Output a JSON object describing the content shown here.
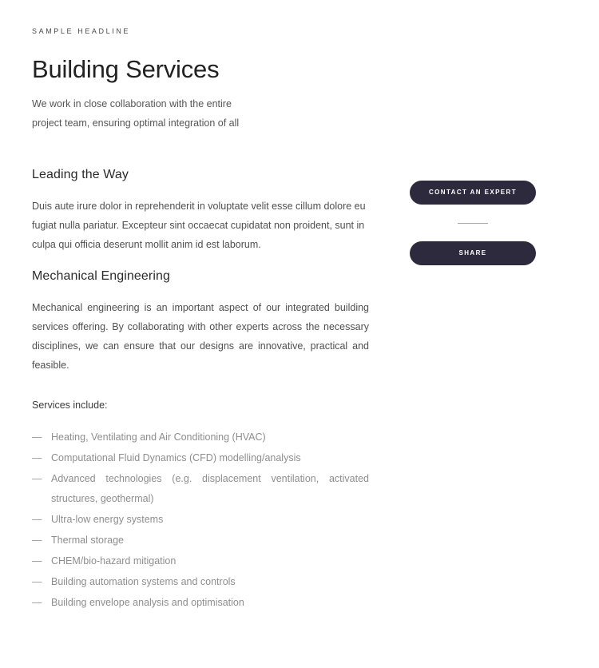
{
  "page": {
    "eyebrow": "SAMPLE HEADLINE",
    "title": "Building Services",
    "intro": "We work in close collaboration with the entire project team, ensuring optimal integration of all"
  },
  "sections": [
    {
      "heading": "Leading the Way",
      "body": "Duis aute irure dolor in reprehenderit in voluptate velit esse cillum dolore eu fugiat nulla pariatur. Excepteur sint occaecat cupidatat non proident, sunt in culpa qui officia deserunt mollit anim id est laborum."
    },
    {
      "heading": "Mechanical Engineering",
      "body": "Mechanical engineering is an important aspect of our integrated building services offering. By collaborating with other experts across the necessary disciplines, we can ensure that our designs are innovative, practical and feasible.",
      "services_label": "Services include:",
      "services": [
        "Heating, Ventilating and Air Conditioning (HVAC)",
        "Computational Fluid Dynamics (CFD) modelling/analysis",
        "Advanced technologies (e.g. displacement ventilation, activated structures, geothermal)",
        "Ultra-low energy systems",
        "Thermal storage",
        "CHEM/bio-hazard mitigation",
        "Building automation systems and controls",
        "Building envelope analysis and optimisation"
      ]
    }
  ],
  "actions": {
    "contact_label": "Contact an Expert",
    "share_label": "Share",
    "list_marker": "—"
  },
  "colors": {
    "button_background": "#2e2a3e",
    "button_text": "#ffffff",
    "page_background": "#ffffff",
    "divider": "#a8a8a8",
    "list_text": "#8e8e8e",
    "body_text": "#4f4f4f",
    "heading_text": "#2b2b2b"
  }
}
